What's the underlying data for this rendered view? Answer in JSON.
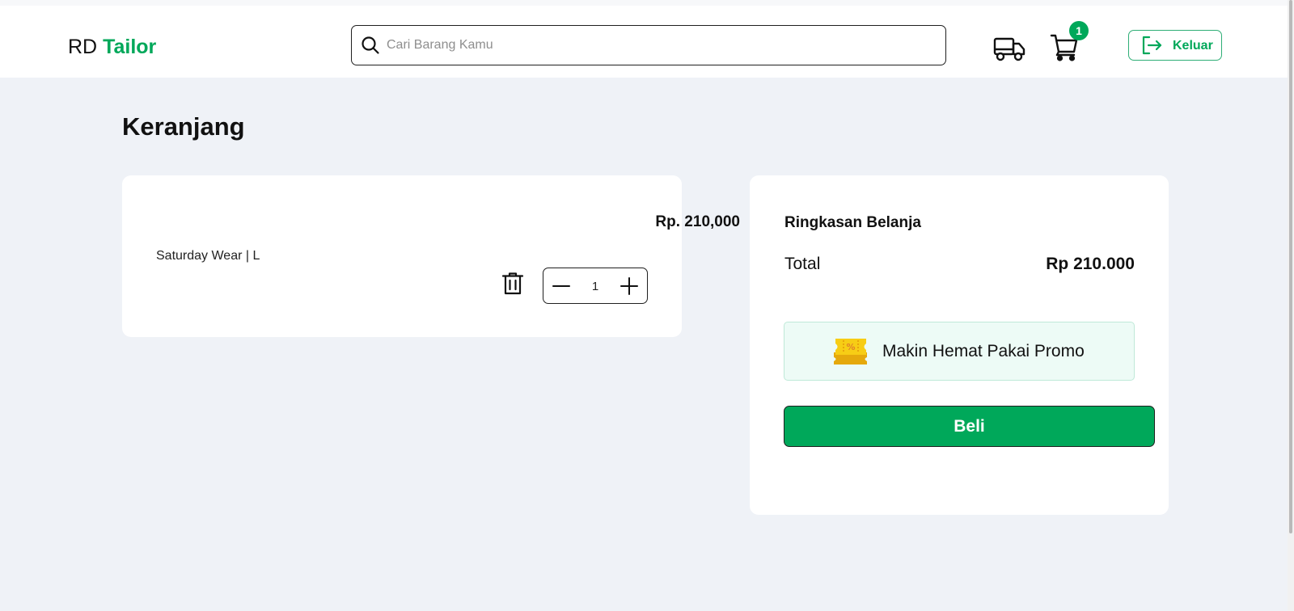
{
  "header": {
    "brand_prefix": "RD",
    "brand_accent": "Tailor",
    "search": {
      "placeholder": "Cari Barang Kamu",
      "value": "",
      "icon": "search-icon"
    },
    "shipping_icon": "truck-icon",
    "cart_icon": "cart-icon",
    "cart_count": "1",
    "logout_label": "Keluar",
    "logout_icon": "logout-icon"
  },
  "page": {
    "title": "Keranjang"
  },
  "cart": {
    "items": [
      {
        "name": "Saturday Wear | L",
        "price": "Rp. 210,000",
        "quantity": "1",
        "delete_icon": "trash-icon",
        "decrement_icon": "minus-icon",
        "increment_icon": "plus-icon"
      }
    ]
  },
  "summary": {
    "title": "Ringkasan Belanja",
    "total_label": "Total",
    "total_value": "Rp 210.000",
    "promo_label": "Makin Hemat Pakai Promo",
    "promo_icon": "promo-ticket-icon",
    "buy_label": "Beli"
  },
  "colors": {
    "accent": "#00a85a",
    "page_background": "#eff2f7",
    "card_background": "#ffffff",
    "promo_background": "#edfbf6",
    "promo_border": "#bfe9d8",
    "logout_border": "#2eae76",
    "ticket_yellow": "#f7cd15"
  }
}
